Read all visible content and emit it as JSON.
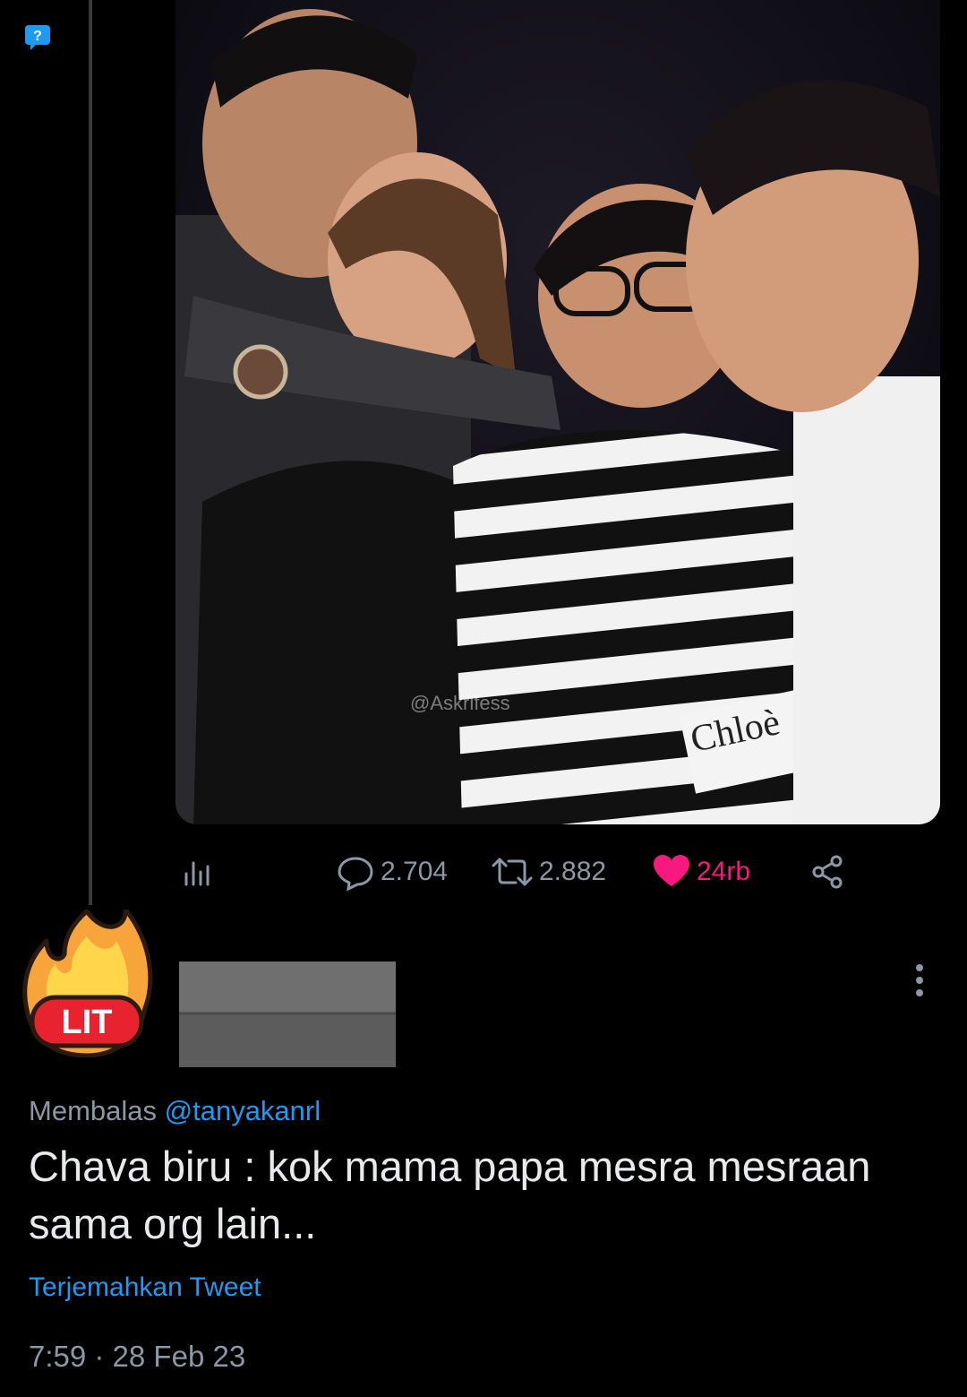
{
  "photo": {
    "watermark": "@Askrlfess",
    "sweater_label": "Chloè"
  },
  "actions": {
    "replies": "2.704",
    "retweets": "2.882",
    "likes": "24rb"
  },
  "reply": {
    "replying_prefix": "Membalas",
    "replying_handle": "@tanyakanrl",
    "text": "Chava biru : kok mama papa mesra mesraan sama org lain...",
    "translate_label": "Terjemahkan Tweet",
    "timestamp": "7:59 · 28 Feb 23",
    "avatar_badge": "LIT"
  },
  "colors": {
    "background": "#000000",
    "accent_blue": "#1d9bf0",
    "like_pink": "#f91880",
    "muted_text": "#8b98a5"
  },
  "icons": [
    "analytics-icon",
    "reply-icon",
    "retweet-icon",
    "heart-icon",
    "share-icon",
    "more-icon"
  ]
}
